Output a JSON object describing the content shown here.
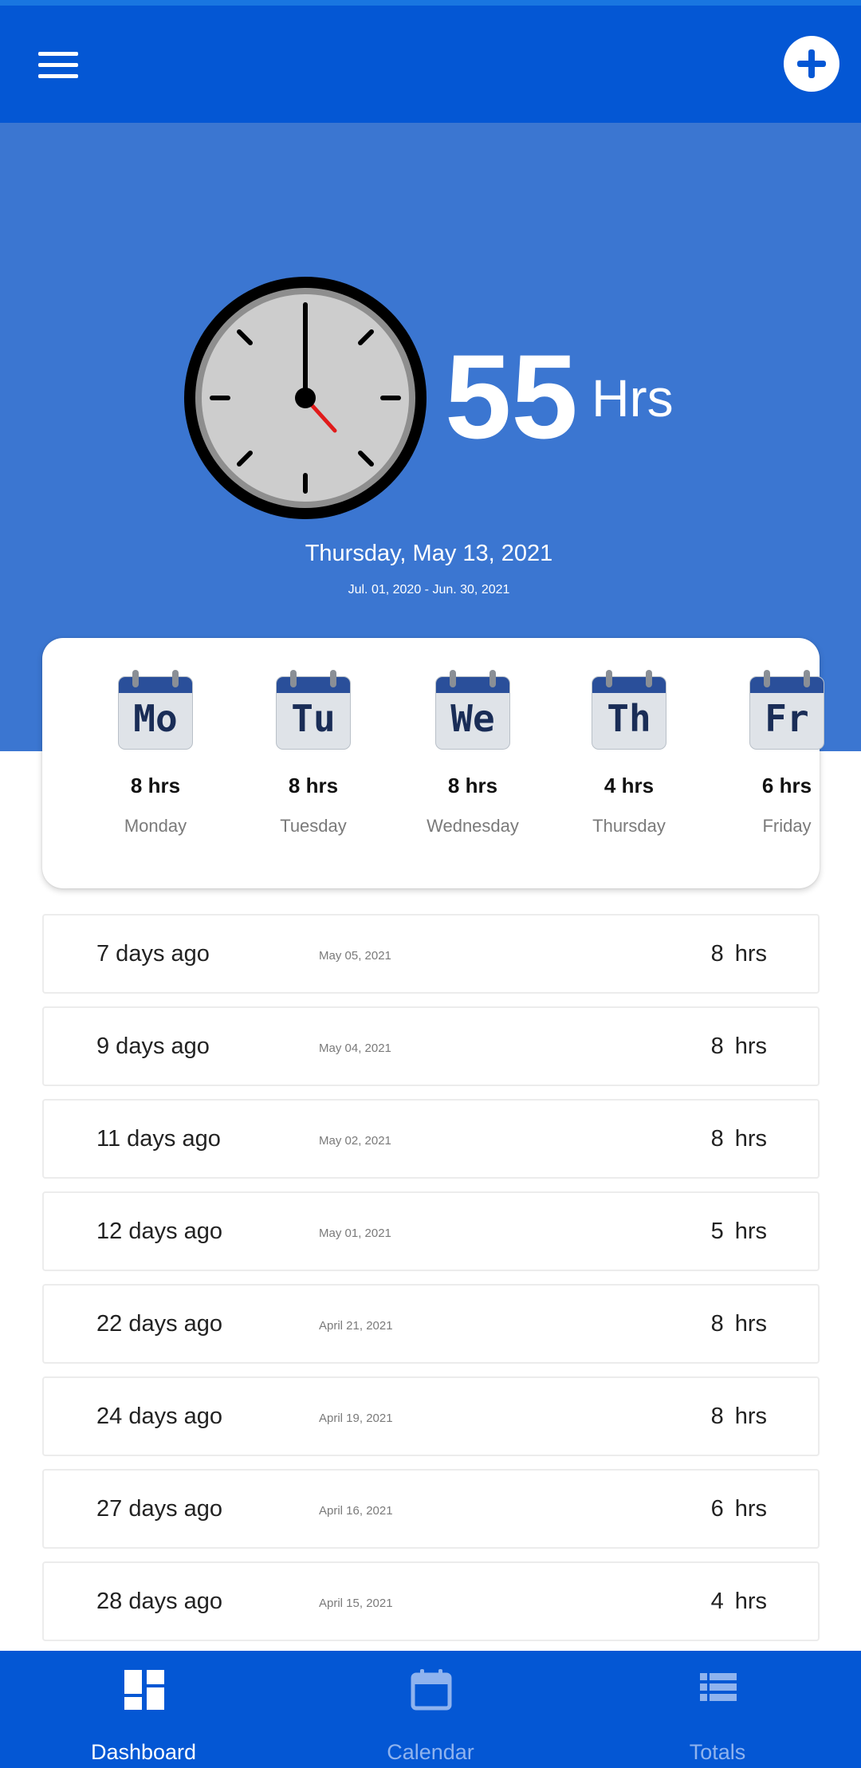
{
  "app_bar": {
    "menu_icon": "hamburger-menu-icon",
    "add_icon": "plus-circle-icon"
  },
  "summary": {
    "total_hours": "55",
    "hours_unit": "Hrs",
    "clock_icon": "wall-clock-icon",
    "current_date": "Thursday, May 13, 2021",
    "period_range": "Jul. 01, 2020 - Jun. 30, 2021"
  },
  "week": [
    {
      "abbr": "Mo",
      "hours": "8 hrs",
      "name": "Monday"
    },
    {
      "abbr": "Tu",
      "hours": "8 hrs",
      "name": "Tuesday"
    },
    {
      "abbr": "We",
      "hours": "8 hrs",
      "name": "Wednesday"
    },
    {
      "abbr": "Th",
      "hours": "4 hrs",
      "name": "Thursday"
    },
    {
      "abbr": "Fr",
      "hours": "6 hrs",
      "name": "Friday"
    }
  ],
  "entries": [
    {
      "ago": "7 days ago",
      "date": "May 05, 2021",
      "hours": "8",
      "unit": "hrs"
    },
    {
      "ago": "9 days ago",
      "date": "May 04, 2021",
      "hours": "8",
      "unit": "hrs"
    },
    {
      "ago": "11 days ago",
      "date": "May 02, 2021",
      "hours": "8",
      "unit": "hrs"
    },
    {
      "ago": "12 days ago",
      "date": "May 01, 2021",
      "hours": "5",
      "unit": "hrs"
    },
    {
      "ago": "22 days ago",
      "date": "April 21, 2021",
      "hours": "8",
      "unit": "hrs"
    },
    {
      "ago": "24 days ago",
      "date": "April 19, 2021",
      "hours": "8",
      "unit": "hrs"
    },
    {
      "ago": "27 days ago",
      "date": "April 16, 2021",
      "hours": "6",
      "unit": "hrs"
    },
    {
      "ago": "28 days ago",
      "date": "April 15, 2021",
      "hours": "4",
      "unit": "hrs"
    }
  ],
  "bottom_nav": {
    "items": [
      {
        "label": "Dashboard",
        "icon": "dashboard-icon",
        "active": true
      },
      {
        "label": "Calendar",
        "icon": "calendar-icon",
        "active": false
      },
      {
        "label": "Totals",
        "icon": "list-icon",
        "active": false
      }
    ]
  },
  "colors": {
    "app_bar": "#0457d4",
    "hero": "#3b76d1",
    "clock_second_hand": "#e01b1b"
  }
}
